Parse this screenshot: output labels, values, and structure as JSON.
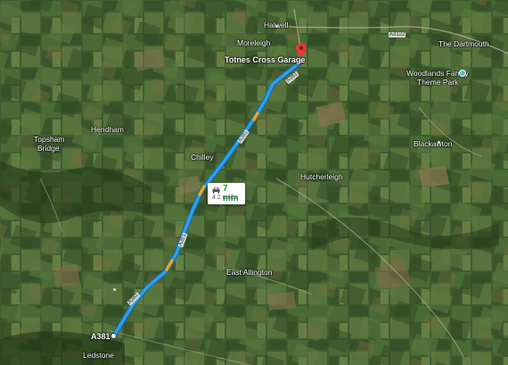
{
  "map": {
    "places": [
      {
        "key": "halwell",
        "text": "Halwell"
      },
      {
        "key": "moreleigh",
        "text": "Moreleigh"
      },
      {
        "key": "the_dartmouth",
        "text": "The Dartmouth"
      },
      {
        "key": "woodlands_1",
        "text": "Woodlands Family"
      },
      {
        "key": "woodlands_2",
        "text": "Theme Park"
      },
      {
        "key": "hendham",
        "text": "Hendham"
      },
      {
        "key": "topsham_1",
        "text": "Topsham"
      },
      {
        "key": "topsham_2",
        "text": "Bridge"
      },
      {
        "key": "blackawton",
        "text": "Blackawton"
      },
      {
        "key": "chilley",
        "text": "Chilley"
      },
      {
        "key": "hutcherleigh",
        "text": "Hutcherleigh"
      },
      {
        "key": "east_allington",
        "text": "East Allington"
      },
      {
        "key": "ledstone",
        "text": "Ledstone"
      }
    ],
    "destination": {
      "label": "Totnes Cross Garage",
      "icon": "red-pin-icon"
    },
    "origin": {
      "label": "A381",
      "icon": "start-circle-icon"
    },
    "road_labels": {
      "r1": "A381",
      "r2": "A381",
      "r3": "A381",
      "r4": "A381",
      "r5": "A3122"
    },
    "route": {
      "time": "7 min",
      "distance": "4.2 miles",
      "mode_icon": "car-icon",
      "color": "#2c9fe8",
      "traffic_color": "#f4a11a"
    },
    "poi_icon": "theme-park-icon"
  }
}
